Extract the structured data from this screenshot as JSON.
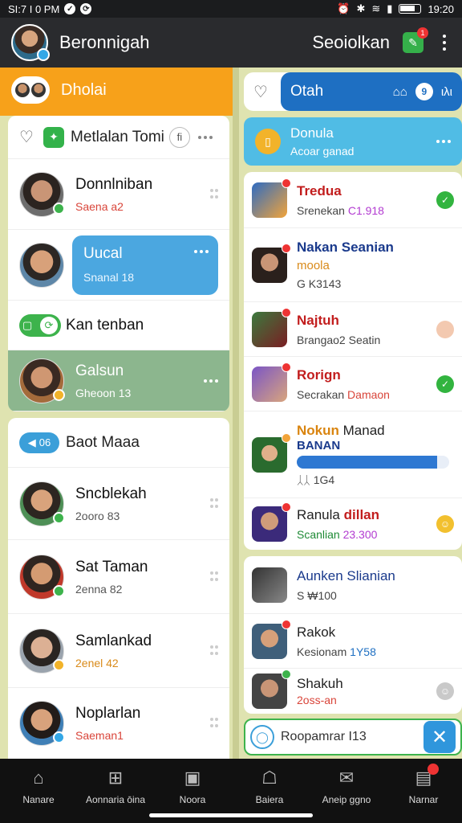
{
  "status_bar": {
    "time_left": "SI:7 I 0 PM",
    "time_right": "19:20"
  },
  "app_bar": {
    "title": "Beronnigah",
    "right_title": "Seoiolkan",
    "notif_count": "1"
  },
  "left": {
    "header_label": "Dholai",
    "card1": {
      "title": "Metlalan Tomi",
      "circle_icon_text": "fi",
      "rows": [
        {
          "name": "Donnlniban",
          "sub": "Saena a2"
        },
        {
          "bubble_title": "Uucal",
          "bubble_sub": "Snanal 18"
        },
        {
          "name": "Kan tenban"
        },
        {
          "name": "Galsun",
          "sub": "Gheoon 13"
        }
      ]
    },
    "card2": {
      "pill": "06",
      "title": "Baot Maaa",
      "rows": [
        {
          "name": "Sncblekah",
          "sub": "2ooro 83"
        },
        {
          "name": "Sat Taman",
          "sub": "2enna 82"
        },
        {
          "name": "Samlankad",
          "sub": "2enel 42"
        },
        {
          "name": "Noplarlan",
          "sub": "Saeman1"
        }
      ]
    }
  },
  "right": {
    "search": {
      "query": "Otah",
      "badge": "9",
      "label": "ιλι"
    },
    "banner": {
      "title": "Donula",
      "sub": "Acoar ganad"
    },
    "list": [
      {
        "name": "Tredua",
        "sub": "Srenekan",
        "extra": "C1.918",
        "status": "✓"
      },
      {
        "name": "Nakan Seanian",
        "sub": "G K3143",
        "extra": "moola"
      },
      {
        "name": "Najtuh",
        "sub": "Brangao2 Seatin"
      },
      {
        "name": "Rorign",
        "sub": "Secrakan",
        "extra": "Damaon",
        "status": "✓"
      },
      {
        "name": "Nokun",
        "name2": "Manad",
        "sub2": "BANAN",
        "sub": "ᛸᛸ 1G4",
        "progress": 0.92
      },
      {
        "name": "Ranula",
        "name2": "dillan",
        "sub": "Scanlian",
        "extra": "23.300"
      },
      {
        "name": "Aunken Slianian",
        "sub": "S ₩100"
      },
      {
        "name": "Rakok",
        "sub": "Kesionam",
        "extra": "1Y58"
      },
      {
        "name": "Shakuh",
        "sub": "2oss-an"
      }
    ],
    "composer": {
      "value": "Roopamrar I13"
    }
  },
  "bottom_nav": [
    {
      "label": "Nanare",
      "icon": "home-icon"
    },
    {
      "label": "Aonnaria ōina",
      "icon": "bookmark-icon"
    },
    {
      "label": "Noora",
      "icon": "inbox-icon"
    },
    {
      "label": "Baiera",
      "icon": "bell-icon"
    },
    {
      "label": "Aneip ggno",
      "icon": "mail-icon"
    },
    {
      "label": "Narnar",
      "icon": "messages-icon"
    }
  ]
}
